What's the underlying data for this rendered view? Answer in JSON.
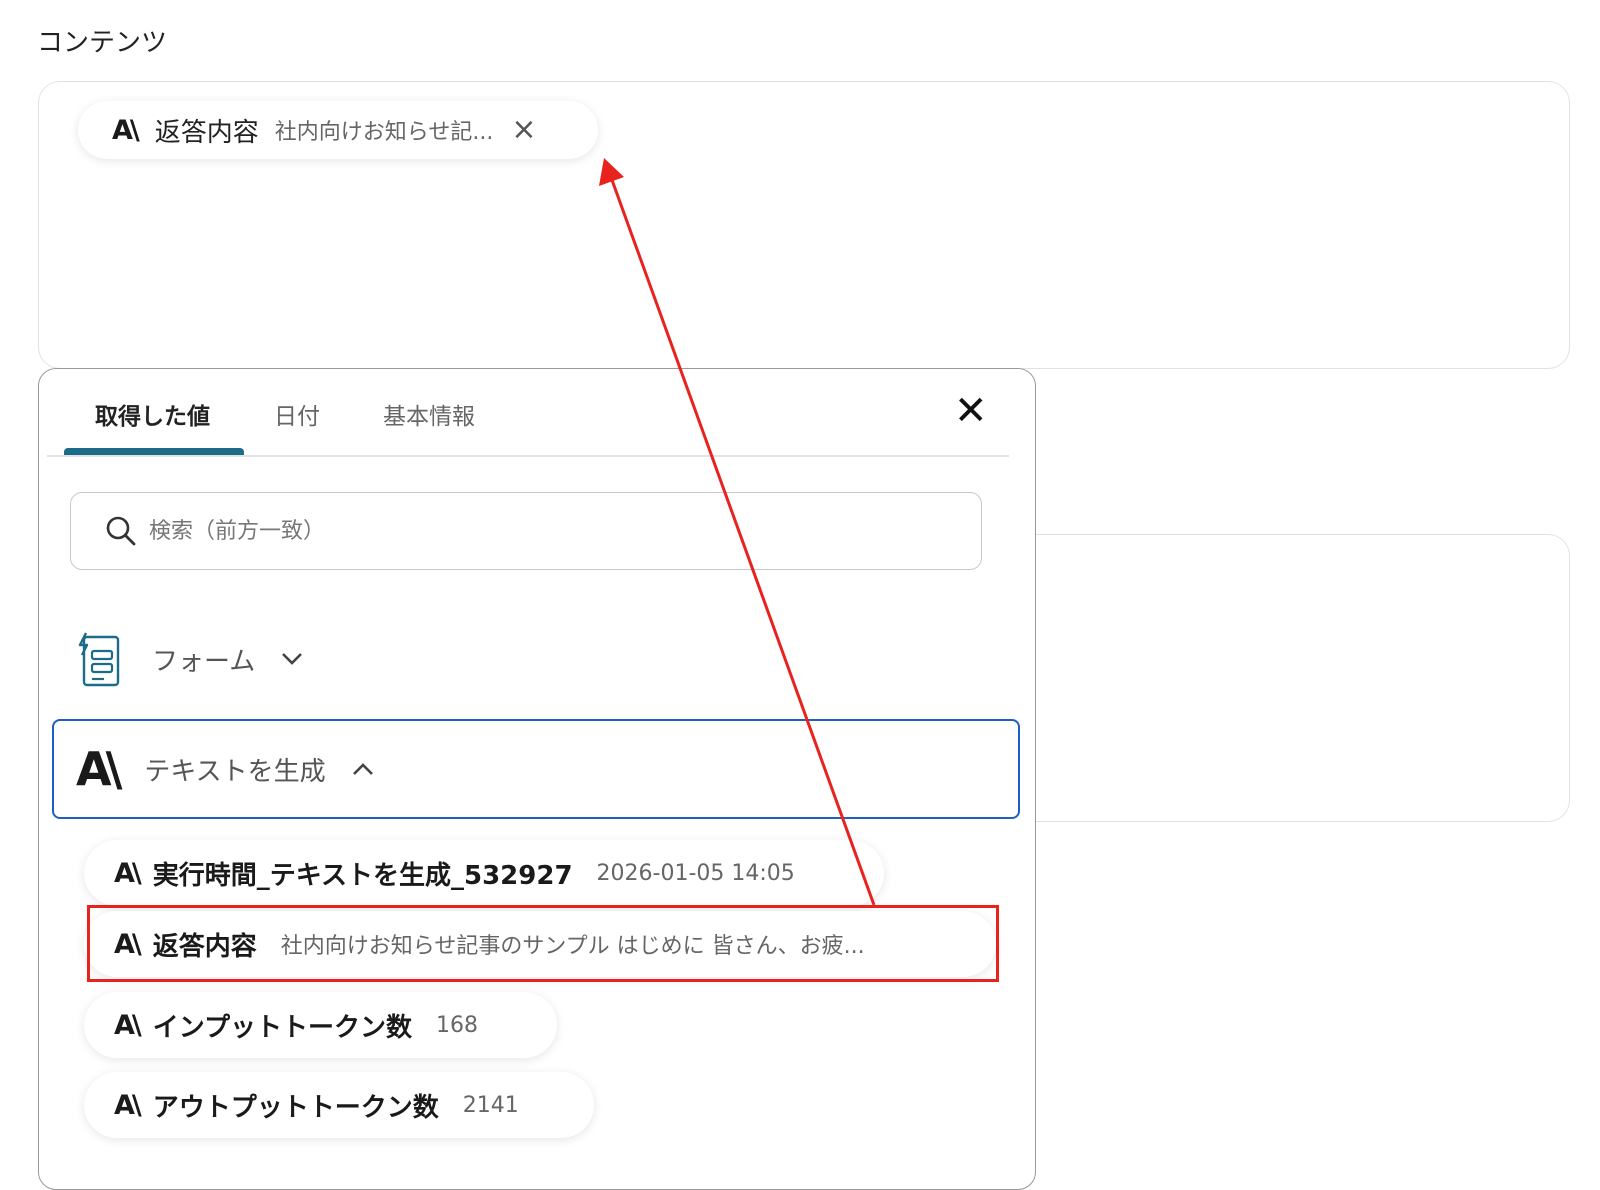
{
  "section": {
    "title": "コンテンツ"
  },
  "selected_chip": {
    "label": "返答内容",
    "value": "社内向けお知らせ記...",
    "close": "×"
  },
  "panel": {
    "tabs": [
      "取得した値",
      "日付",
      "基本情報"
    ],
    "active_tab": "取得した値",
    "close": "✕",
    "search": {
      "placeholder": "検索（前方一致）",
      "value": ""
    },
    "groups": [
      {
        "label": "フォーム",
        "expanded": false,
        "icon": "form-icon"
      },
      {
        "label": "テキストを生成",
        "expanded": true,
        "icon": "ai-logo-icon"
      }
    ],
    "items": [
      {
        "label": "実行時間_テキストを生成_532927",
        "value": "2026-01-05 14:05"
      },
      {
        "label": "返答内容",
        "value": "社内向けお知らせ記事のサンプル はじめに 皆さん、お疲..."
      },
      {
        "label": "インプットトークン数",
        "value": "168"
      },
      {
        "label": "アウトプットトークン数",
        "value": "2141"
      }
    ]
  },
  "logo_text": "A\\",
  "colors": {
    "tab_accent": "#1c6b88",
    "focus_border": "#1d5fc4",
    "annotation_red": "#e8231e"
  }
}
